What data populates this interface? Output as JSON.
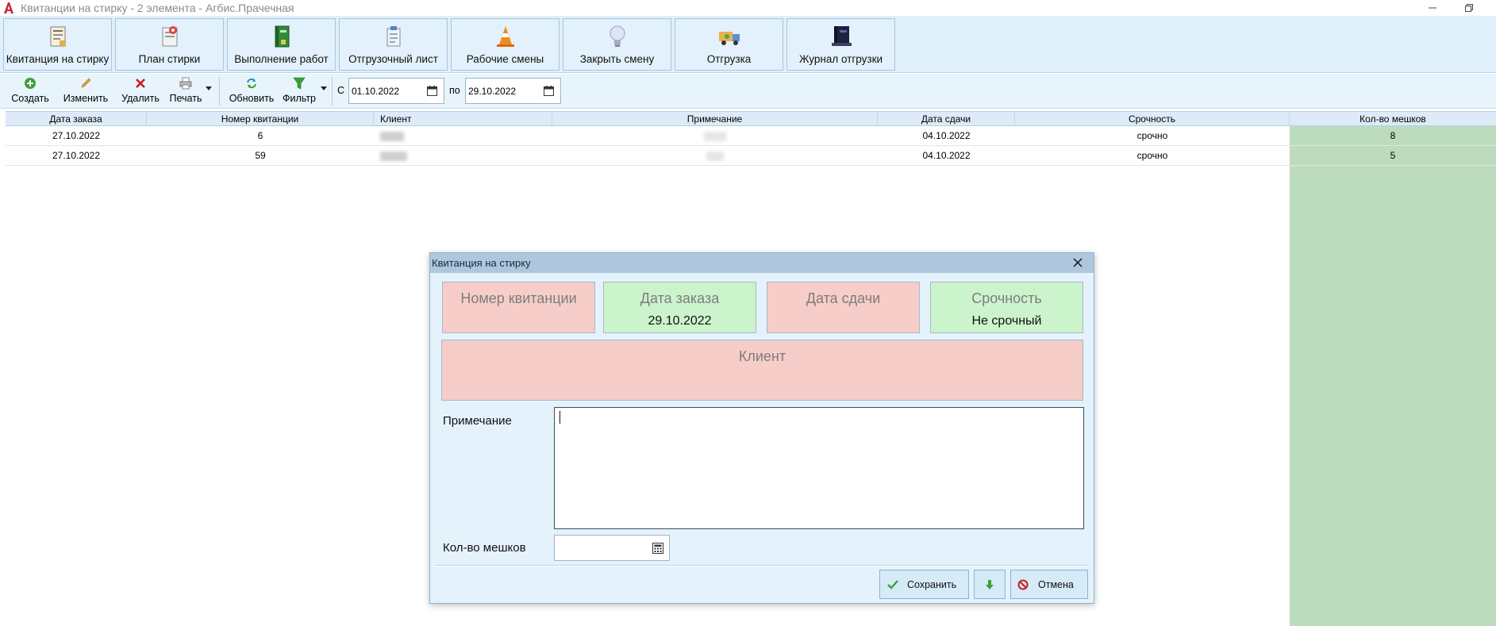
{
  "window": {
    "title": "Квитанции на стирку - 2 элемента - Агбис.Прачечная",
    "logo_letter": "A"
  },
  "ribbon": [
    {
      "label": "Квитанция на стирку",
      "icon": "receipt-icon"
    },
    {
      "label": "План стирки",
      "icon": "laundry-plan-icon"
    },
    {
      "label": "Выполнение работ",
      "icon": "book-icon"
    },
    {
      "label": "Отгрузочный лист",
      "icon": "clipboard-icon"
    },
    {
      "label": "Рабочие смены",
      "icon": "traffic-cone-icon"
    },
    {
      "label": "Закрыть смену",
      "icon": "lightbulb-icon"
    },
    {
      "label": "Отгрузка",
      "icon": "truck-icon"
    },
    {
      "label": "Журнал отгрузки",
      "icon": "journal-icon"
    }
  ],
  "toolbar": {
    "create": "Создать",
    "edit": "Изменить",
    "delete": "Удалить",
    "print": "Печать",
    "refresh": "Обновить",
    "filter": "Фильтр",
    "from_label": "С",
    "from_date": "01.10.2022",
    "to_label": "по",
    "to_date": "29.10.2022"
  },
  "grid": {
    "columns": [
      "Дата заказа",
      "Номер квитанции",
      "Клиент",
      "Примечание",
      "Дата сдачи",
      "Срочность",
      "Кол-во мешков"
    ],
    "rows": [
      {
        "order_date": "27.10.2022",
        "number": "6",
        "client": "",
        "note": "",
        "due_date": "04.10.2022",
        "urgency": "срочно",
        "bags": "8"
      },
      {
        "order_date": "27.10.2022",
        "number": "59",
        "client": "",
        "note": "",
        "due_date": "04.10.2022",
        "urgency": "срочно",
        "bags": "5"
      }
    ],
    "highlight_color": "#bddcbe"
  },
  "dialog": {
    "title": "Квитанция на стирку",
    "cards": {
      "number_label": "Номер квитанции",
      "order_date_label": "Дата заказа",
      "order_date_value": "29.10.2022",
      "due_date_label": "Дата сдачи",
      "urgency_label": "Срочность",
      "urgency_value": "Не срочный",
      "client_label": "Клиент"
    },
    "note_label": "Примечание",
    "note_value": "",
    "bags_label": "Кол-во мешков",
    "bags_value": "",
    "save": "Сохранить",
    "cancel": "Отмена",
    "colors": {
      "required": "#f6cdc8",
      "filled": "#ccf4cc"
    }
  }
}
